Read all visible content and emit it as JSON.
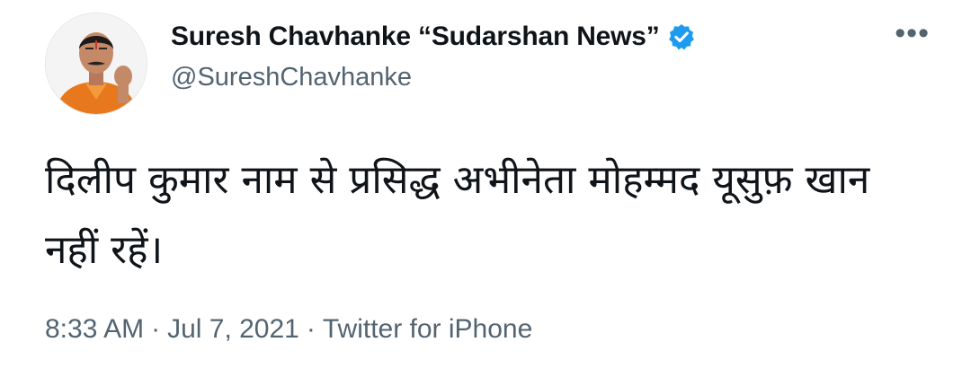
{
  "author": {
    "display_name": "Suresh Chavhanke “Sudarshan News”",
    "handle": "@SureshChavhanke",
    "verified_icon": "verified-badge-icon",
    "avatar_icon": "profile-avatar"
  },
  "more_icon": "more-options-icon",
  "more_glyph": "•••",
  "tweet": {
    "text": "दिलीप कुमार नाम से प्रसिद्ध अभीनेता मोहम्मद यूसुफ़ खान नहीं रहें।"
  },
  "meta": {
    "time": "8:33 AM",
    "separator": "·",
    "date": "Jul 7, 2021",
    "source": "Twitter for iPhone"
  },
  "colors": {
    "text": "#0f1419",
    "secondary": "#536471",
    "verified_blue": "#1d9bf0",
    "avatar_saffron": "#e8781e"
  }
}
